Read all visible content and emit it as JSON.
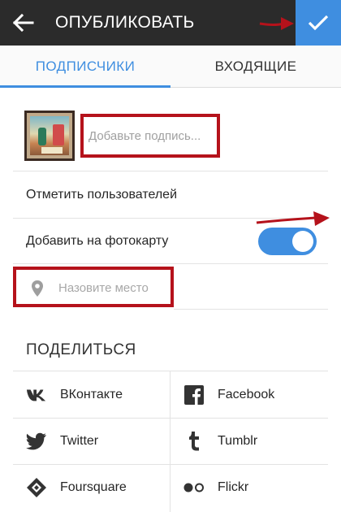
{
  "header": {
    "title": "ОПУБЛИКОВАТЬ"
  },
  "tabs": [
    {
      "label": "ПОДПИСЧИКИ",
      "active": true
    },
    {
      "label": "ВХОДЯЩИЕ",
      "active": false
    }
  ],
  "caption": {
    "placeholder": "Добавьте подпись..."
  },
  "rows": {
    "tag_people": "Отметить пользователей",
    "add_to_map": "Добавить на фотокарту",
    "add_to_map_enabled": true
  },
  "location": {
    "placeholder": "Назовите место"
  },
  "share": {
    "title": "ПОДЕЛИТЬСЯ",
    "services": [
      {
        "label": "ВКонтакте",
        "icon": "vk-icon"
      },
      {
        "label": "Facebook",
        "icon": "facebook-icon"
      },
      {
        "label": "Twitter",
        "icon": "twitter-icon"
      },
      {
        "label": "Tumblr",
        "icon": "tumblr-icon"
      },
      {
        "label": "Foursquare",
        "icon": "foursquare-icon"
      },
      {
        "label": "Flickr",
        "icon": "flickr-icon"
      }
    ]
  },
  "colors": {
    "accent": "#3f8ee0",
    "topbar": "#2b2b2b",
    "annotation": "#b5121b"
  }
}
